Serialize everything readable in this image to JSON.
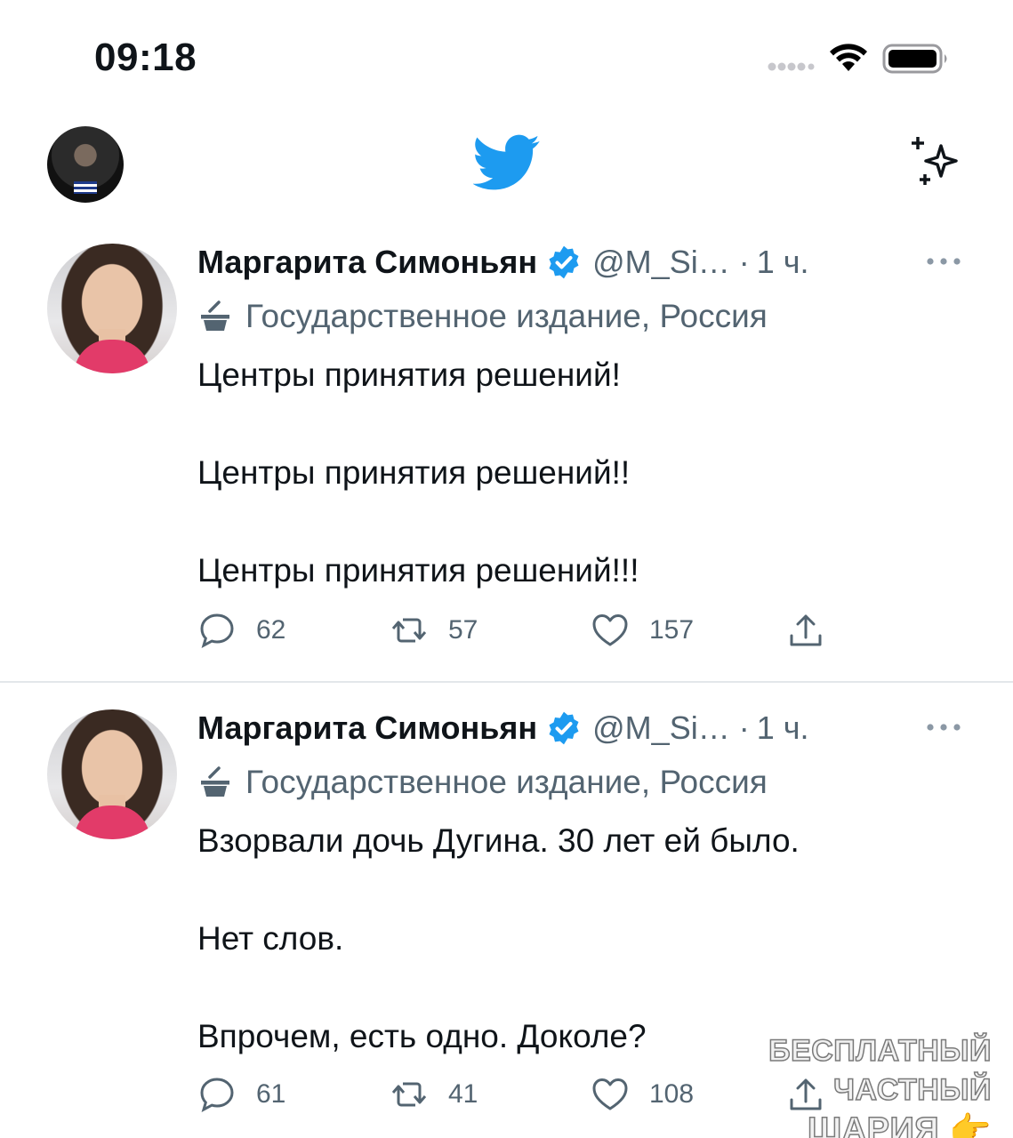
{
  "status_bar": {
    "time": "09:18"
  },
  "nav": {
    "logo": "twitter-bird-icon",
    "right_icon": "sparkle-icon"
  },
  "colors": {
    "brand": "#1d9bf0",
    "muted": "#536471",
    "text": "#0f1419"
  },
  "tweets": [
    {
      "author": "Маргарита Симоньян",
      "handle": "@M_Si…",
      "separator": "·",
      "time": "1 ч.",
      "label": "Государственное издание, Россия",
      "paragraphs": [
        "Центры принятия решений!",
        "Центры принятия решений!!",
        "Центры принятия решений!!!"
      ],
      "replies": "62",
      "retweets": "57",
      "likes": "157"
    },
    {
      "author": "Маргарита Симоньян",
      "handle": "@M_Si…",
      "separator": "·",
      "time": "1 ч.",
      "label": "Государственное издание, Россия",
      "paragraphs": [
        "Взорвали дочь Дугина. 30 лет ей было.",
        "Нет слов.",
        "Впрочем, есть одно. Доколе?"
      ],
      "replies": "61",
      "retweets": "41",
      "likes": "108"
    }
  ],
  "watermark": {
    "line1": "БЕСПЛАТНЫЙ ЧАСТНЫЙ",
    "line2": "ШАРИЯ 👉 Sharij.net"
  }
}
